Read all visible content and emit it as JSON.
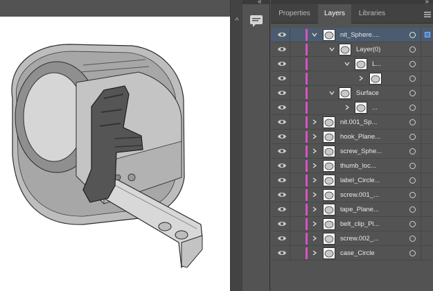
{
  "dock": {
    "collapse_left": "«",
    "collapse_right": "»",
    "comments_icon": "speech-bubble-icon"
  },
  "canvas": {
    "scroll_up_glyph": "^"
  },
  "panel": {
    "tabs": [
      {
        "label": "Properties",
        "active": false
      },
      {
        "label": "Layers",
        "active": true
      },
      {
        "label": "Libraries",
        "active": false
      }
    ],
    "menu_icon": "hamburger-icon"
  },
  "layers": [
    {
      "name": "nit_Sphere....",
      "level": 0,
      "expanded": true,
      "selected": true
    },
    {
      "name": "Layer(0)",
      "level": 1,
      "expanded": true,
      "selected": false
    },
    {
      "name": "L...",
      "level": 2,
      "expanded": true,
      "selected": false
    },
    {
      "name": "",
      "level": 3,
      "expanded": false,
      "selected": false
    },
    {
      "name": "Surface",
      "level": 1,
      "expanded": true,
      "selected": false
    },
    {
      "name": "...",
      "level": 2,
      "expanded": false,
      "selected": false
    },
    {
      "name": "nit.001_Sp...",
      "level": 0,
      "expanded": false,
      "selected": false
    },
    {
      "name": "hook_Plane...",
      "level": 0,
      "expanded": false,
      "selected": false
    },
    {
      "name": "screw_Sphe...",
      "level": 0,
      "expanded": false,
      "selected": false
    },
    {
      "name": "thumb_loc...",
      "level": 0,
      "expanded": false,
      "selected": false
    },
    {
      "name": "label_Circle...",
      "level": 0,
      "expanded": false,
      "selected": false
    },
    {
      "name": "screw.001_...",
      "level": 0,
      "expanded": false,
      "selected": false
    },
    {
      "name": "tape_Plane...",
      "level": 0,
      "expanded": false,
      "selected": false
    },
    {
      "name": "belt_clip_Pl...",
      "level": 0,
      "expanded": false,
      "selected": false
    },
    {
      "name": "screw.002_...",
      "level": 0,
      "expanded": false,
      "selected": false
    },
    {
      "name": "case_Circle",
      "level": 0,
      "expanded": false,
      "selected": false
    }
  ],
  "colors": {
    "layer_color": "#d852c6",
    "selection": "#4a7fd3",
    "panel_bg": "#535353"
  }
}
